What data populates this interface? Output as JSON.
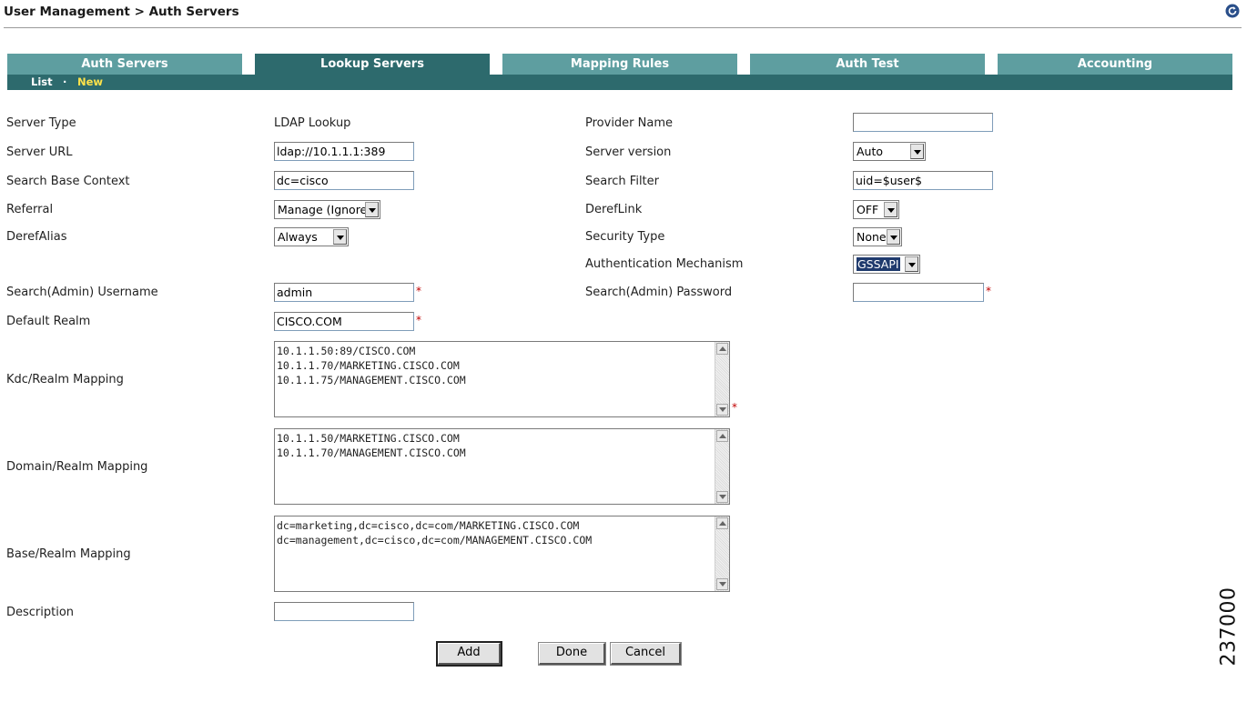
{
  "breadcrumb": "User Management > Auth Servers",
  "tabs": [
    {
      "label": "Auth Servers",
      "active": false
    },
    {
      "label": "Lookup Servers",
      "active": true
    },
    {
      "label": "Mapping Rules",
      "active": false
    },
    {
      "label": "Auth Test",
      "active": false
    },
    {
      "label": "Accounting",
      "active": false
    }
  ],
  "subnav": {
    "list": "List",
    "separator": "·",
    "new": "New"
  },
  "form": {
    "server_type": {
      "label": "Server Type",
      "value": "LDAP Lookup"
    },
    "server_url": {
      "label": "Server URL",
      "value": "ldap://10.1.1.1:389"
    },
    "search_base_context": {
      "label": "Search Base Context",
      "value": "dc=cisco"
    },
    "referral": {
      "label": "Referral",
      "value": "Manage (Ignore)"
    },
    "deref_alias": {
      "label": "DerefAlias",
      "value": "Always"
    },
    "admin_username": {
      "label": "Search(Admin) Username",
      "value": "admin"
    },
    "default_realm": {
      "label": "Default Realm",
      "value": "CISCO.COM"
    },
    "kdc_realm_mapping": {
      "label": "Kdc/Realm Mapping",
      "lines": [
        "10.1.1.50:89/CISCO.COM",
        "10.1.1.70/MARKETING.CISCO.COM",
        "10.1.1.75/MANAGEMENT.CISCO.COM"
      ]
    },
    "domain_realm_mapping": {
      "label": "Domain/Realm Mapping",
      "lines": [
        "10.1.1.50/MARKETING.CISCO.COM",
        "10.1.1.70/MANAGEMENT.CISCO.COM"
      ]
    },
    "base_realm_mapping": {
      "label": "Base/Realm Mapping",
      "lines": [
        "dc=marketing,dc=cisco,dc=com/MARKETING.CISCO.COM",
        "dc=management,dc=cisco,dc=com/MANAGEMENT.CISCO.COM"
      ]
    },
    "description": {
      "label": "Description",
      "value": ""
    },
    "provider_name": {
      "label": "Provider Name",
      "value": ""
    },
    "server_version": {
      "label": "Server version",
      "value": "Auto"
    },
    "search_filter": {
      "label": "Search Filter",
      "value": "uid=$user$"
    },
    "dereflink": {
      "label": "DerefLink",
      "value": "OFF"
    },
    "security_type": {
      "label": "Security Type",
      "value": "None"
    },
    "auth_mechanism": {
      "label": "Authentication Mechanism",
      "value": "GSSAPI"
    },
    "admin_password": {
      "label": "Search(Admin) Password",
      "value": ""
    },
    "required_mark": "*"
  },
  "buttons": {
    "add": "Add",
    "done": "Done",
    "cancel": "Cancel"
  },
  "figure_id": "237000"
}
